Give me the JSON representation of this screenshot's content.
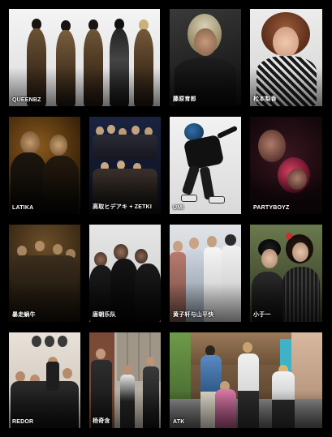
{
  "artists": [
    {
      "label": "QUEENBZ"
    },
    {
      "label": "藤原育郎"
    },
    {
      "label": "松本梨香"
    },
    {
      "label": "LATIKA"
    },
    {
      "label": "高取ヒデアキ + ZETKI"
    },
    {
      "label": "UMI"
    },
    {
      "label": "PARTYBOYZ"
    },
    {
      "label": "暴走蜗牛"
    },
    {
      "label": "唐朝乐队"
    },
    {
      "label": "黄子轩与山平快"
    },
    {
      "label": "小于一"
    },
    {
      "label": "REDOR"
    },
    {
      "label": "杨奇含"
    },
    {
      "label": "ATK"
    }
  ]
}
